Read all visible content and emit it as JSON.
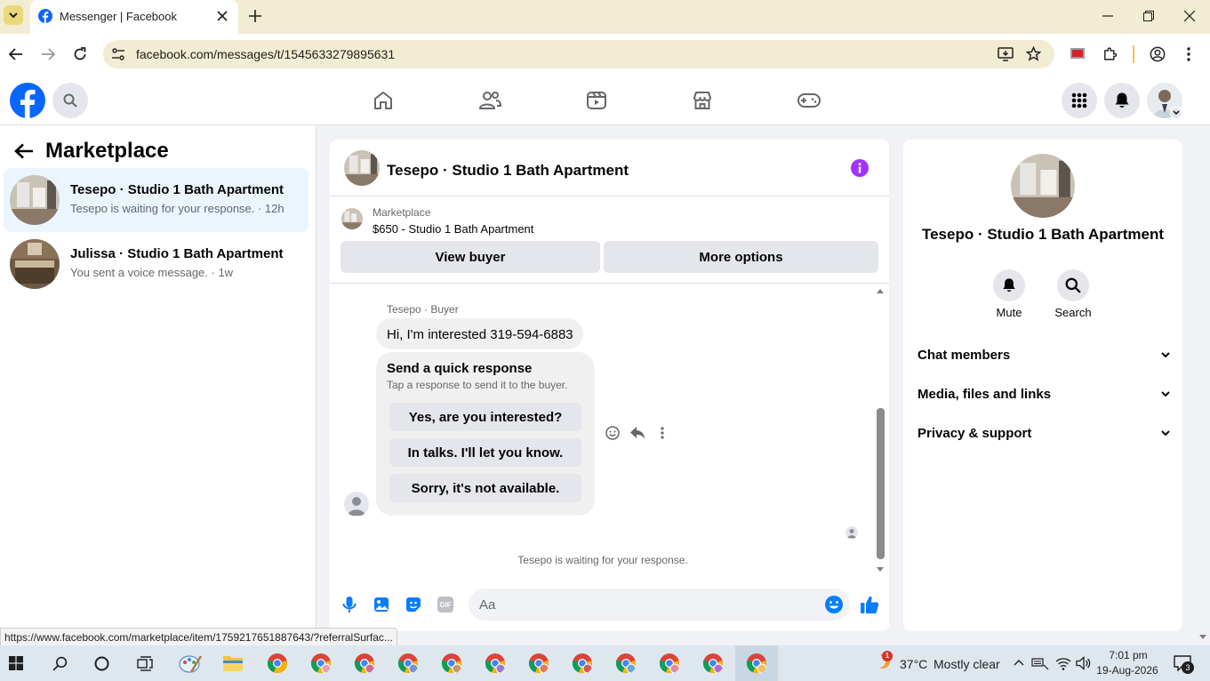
{
  "browser": {
    "tab_title": "Messenger | Facebook",
    "url": "facebook.com/messages/t/1545633279895631",
    "status_url": "https://www.facebook.com/marketplace/item/1759217651887643/?referralSurfac..."
  },
  "sidebar": {
    "title": "Marketplace",
    "conversations": [
      {
        "name": "Tesepo · Studio 1 Bath Apartment",
        "preview": "Tesepo is waiting for your response. · 12h"
      },
      {
        "name": "Julissa · Studio 1 Bath Apartment",
        "preview": "You sent a voice message. · 1w"
      }
    ]
  },
  "chat": {
    "title": "Tesepo · Studio 1 Bath Apartment",
    "listing_label": "Marketplace",
    "listing_title": "$650 - Studio 1 Bath Apartment",
    "view_buyer": "View buyer",
    "more_options": "More options",
    "sender_label": "Tesepo · Buyer",
    "message": "Hi, I'm interested 319-594-6883",
    "quick_title": "Send a quick response",
    "quick_subtitle": "Tap a response to send it to the buyer.",
    "quick_options": [
      "Yes, are you interested?",
      "In talks. I'll let you know.",
      "Sorry, it's not available."
    ],
    "waiting_text": "Tesepo is waiting for your response.",
    "composer_placeholder": "Aa",
    "gif_label": "GIF"
  },
  "details": {
    "name": "Tesepo · Studio 1 Bath Apartment",
    "mute_label": "Mute",
    "search_label": "Search",
    "sections": [
      "Chat members",
      "Media, files and links",
      "Privacy & support"
    ]
  },
  "taskbar": {
    "temperature": "37°C",
    "weather": "Mostly clear",
    "weather_badge": "1",
    "time": "7:01 pm",
    "date": "19-Aug-2026",
    "notification_count": "3"
  },
  "colors": {
    "facebook_blue": "#0866ff",
    "messenger_blue": "#0a7cff",
    "purple_info": "#a033ff",
    "active_conversation": "#ebf5ff"
  }
}
